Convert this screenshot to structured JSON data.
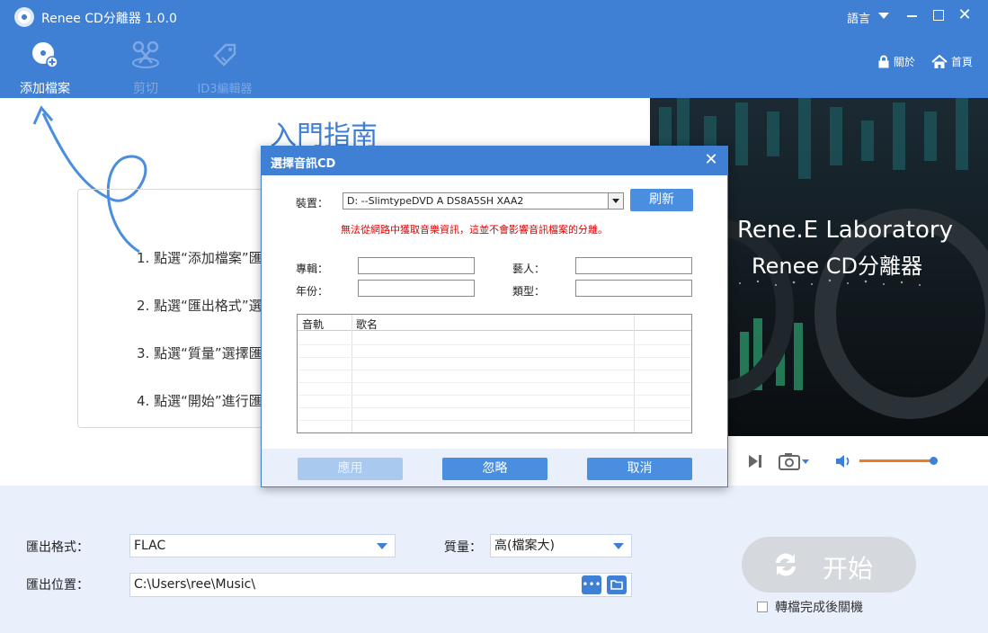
{
  "app": {
    "title": "Renee CD分離器 1.0.0"
  },
  "titlebar": {
    "language": "語言",
    "minimize": "",
    "maximize": "",
    "close": "✕"
  },
  "toolbar": {
    "add_file": "添加檔案",
    "cut": "剪切",
    "id3": "ID3編輯器",
    "about": "關於",
    "home": "首頁"
  },
  "guide": {
    "title": "入門指南",
    "steps": [
      "1. 點選“添加檔案”匯",
      "2. 點選“匯出格式”選",
      "3. 點選“質量”選擇匯",
      "4. 點選“開始”進行匯"
    ]
  },
  "media": {
    "caption1": "Rene.E Laboratory",
    "caption2": "Renee CD分離器",
    "volume_percent": 83,
    "accent_color": "#f07b1e"
  },
  "bottom": {
    "format_label": "匯出格式：",
    "format_value": "FLAC",
    "quality_label": "質量：",
    "quality_value": "高(檔案大)",
    "location_label": "匯出位置：",
    "location_value": "C:\\Users\\ree\\Music\\",
    "browse_dots": "•••",
    "start": "开始",
    "shutdown_label": "轉檔完成後關機"
  },
  "dialog": {
    "title": "選擇音訊CD",
    "device_label": "裝置：",
    "device_value": "D:  --SlimtypeDVD A  DS8A5SH   XAA2",
    "refresh": "刷新",
    "warning": "無法從網路中獲取音樂資訊，這並不會影響音訊檔案的分離。",
    "album_label": "專輯：",
    "artist_label": "藝人：",
    "year_label": "年份：",
    "genre_label": "類型：",
    "col_track": "音軌",
    "col_title": "歌名",
    "apply": "應用",
    "ignore": "忽略",
    "cancel": "取消"
  }
}
